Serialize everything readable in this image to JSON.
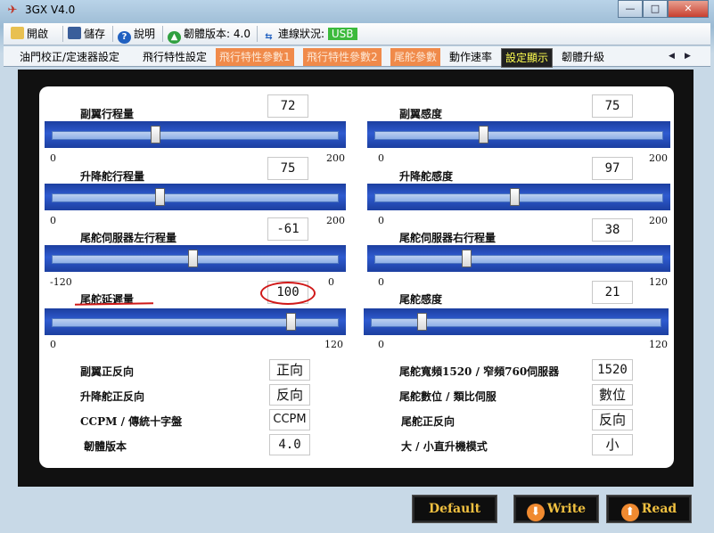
{
  "window": {
    "title": "3GX  V4.0",
    "logo_text": "✈"
  },
  "toolbar": {
    "open_label": "開啟",
    "save_label": "儲存",
    "help_label": "說明",
    "firmware_label": "韌體版本:",
    "firmware_value": "4.0",
    "connection_label": "連線狀況:",
    "connection_value": "USB"
  },
  "tabs": [
    {
      "label": "油門校正/定速器設定"
    },
    {
      "label": "飛行特性設定"
    },
    {
      "label": "飛行特性參數1"
    },
    {
      "label": "飛行特性參數2"
    },
    {
      "label": "尾舵參數"
    },
    {
      "label": "動作速率"
    },
    {
      "label": "設定顯示"
    },
    {
      "label": "韌體升級"
    }
  ],
  "sliders": [
    {
      "label": "副翼行程量",
      "value": "72",
      "min": "0",
      "max": "200",
      "fraction": 0.36
    },
    {
      "label": "副翼感度",
      "value": "75",
      "min": "0",
      "max": "200",
      "fraction": 0.375
    },
    {
      "label": "升降舵行程量",
      "value": "75",
      "min": "0",
      "max": "200",
      "fraction": 0.375
    },
    {
      "label": "升降舵感度",
      "value": "97",
      "min": "0",
      "max": "200",
      "fraction": 0.485
    },
    {
      "label": "尾舵伺服器左行程量",
      "value": "-61",
      "min": "-120",
      "max": "0",
      "fraction": 0.49
    },
    {
      "label": "尾舵伺服器右行程量",
      "value": "38",
      "min": "0",
      "max": "120",
      "fraction": 0.317
    },
    {
      "label": "尾舵延遲量",
      "value": "100",
      "min": "0",
      "max": "120",
      "fraction": 0.833
    },
    {
      "label": "尾舵感度",
      "value": "21",
      "min": "0",
      "max": "120",
      "fraction": 0.175
    }
  ],
  "options_left": [
    {
      "label": "副翼正反向",
      "value": "正向"
    },
    {
      "label": "升降舵正反向",
      "value": "反向"
    },
    {
      "label": "CCPM / 傳統十字盤",
      "value": "CCPM"
    },
    {
      "label": "韌體版本",
      "value": "4.0"
    }
  ],
  "options_right": [
    {
      "label": "尾舵寬頻1520 / 窄頻760伺服器",
      "value": "1520"
    },
    {
      "label": "尾舵數位 / 類比伺服",
      "value": "數位"
    },
    {
      "label": "尾舵正反向",
      "value": "反向"
    },
    {
      "label": "大 / 小直升機模式",
      "value": "小"
    }
  ],
  "buttons": {
    "default_label": "Default",
    "write_label": "Write",
    "read_label": "Read"
  },
  "colors": {
    "accent_orange": "#f08a4a",
    "active_tab_text": "#ffff50",
    "slider_blue": "#2f5bd0",
    "annotation_red": "#d01818"
  }
}
